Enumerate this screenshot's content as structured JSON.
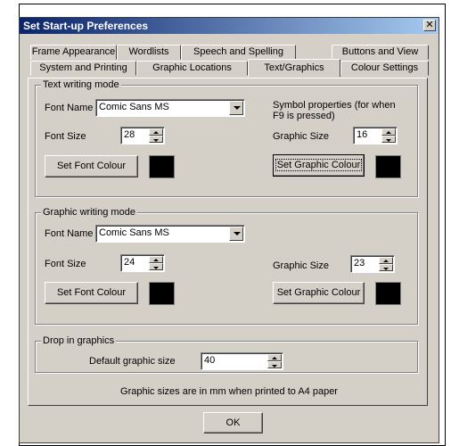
{
  "window": {
    "title": "Set Start-up Preferences",
    "close_glyph": "✕"
  },
  "tabs_row_back": [
    "Frame Appearance",
    "Wordlists",
    "Speech and Spelling",
    "Buttons and View"
  ],
  "tabs_row_front": [
    "System and Printing",
    "Graphic Locations",
    "Text/Graphics",
    "Colour Settings"
  ],
  "active_tab": "Text/Graphics",
  "text_mode": {
    "title": "Text writing mode",
    "font_name_label": "Font Name",
    "font_name": "Comic Sans MS",
    "font_size_label": "Font Size",
    "font_size": "28",
    "set_font_colour": "Set Font Colour",
    "font_colour": "#000000",
    "symbol_props": "Symbol properties (for when F9 is pressed)",
    "graphic_size_label": "Graphic Size",
    "graphic_size": "16",
    "set_graphic_colour": "Set Graphic Colour",
    "graphic_colour": "#000000"
  },
  "graphic_mode": {
    "title": "Graphic writing mode",
    "font_name_label": "Font Name",
    "font_name": "Comic Sans MS",
    "font_size_label": "Font Size",
    "font_size": "24",
    "set_font_colour": "Set Font Colour",
    "font_colour": "#000000",
    "graphic_size_label": "Graphic Size",
    "graphic_size": "23",
    "set_graphic_colour": "Set Graphic Colour",
    "graphic_colour": "#000000"
  },
  "drop_in": {
    "title": "Drop in graphics",
    "default_size_label": "Default graphic size",
    "default_size": "40"
  },
  "footnote": "Graphic sizes are in mm when printed to A4 paper",
  "ok_label": "OK"
}
